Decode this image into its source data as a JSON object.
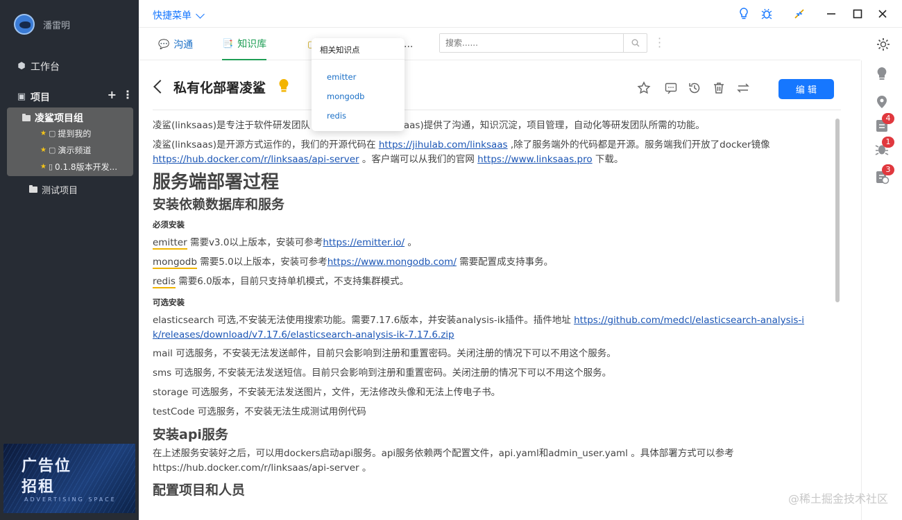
{
  "sidebar": {
    "username": "潘雷明",
    "workbench": "工作台",
    "projects": "项目",
    "group": {
      "title": "凌鲨项目组",
      "items": [
        {
          "label": "提到我的"
        },
        {
          "label": "演示频道"
        },
        {
          "label": "0.1.8版本开发..."
        }
      ]
    },
    "test_project": "测试项目",
    "ad": {
      "line1": "广告位",
      "line2": "招租",
      "line3": "ADVERTISING SPACE"
    }
  },
  "topbar": {
    "quick_menu": "快捷菜单"
  },
  "tabs": [
    {
      "label": "沟通"
    },
    {
      "label": "知识库"
    },
    {
      "label": "..."
    }
  ],
  "search": {
    "placeholder": "搜索......"
  },
  "rail_badges": {
    "b1": "4",
    "b2": "1",
    "b3": "3"
  },
  "doc": {
    "title": "私有化部署凌鲨",
    "edit_label": "编 辑",
    "p1a": "凌鲨(linksaas)是专注于软件研发团队",
    "p1b": "ksaas)提供了沟通，知识沉淀，项目管理，自动化等研发团队所需的功能。",
    "p2a": "凌鲨(linksaas)是开源方式运作的，我们的开源代码在 ",
    "p2_link1": "https://jihulab.com/linksaas",
    "p2b": " ,除了服务端外的代码都是开源。服务端我们开放了docker镜像",
    "p2_link2": "https://hub.docker.com/r/linksaas/api-server",
    "p2c": " 。客户端可以从我们的官网 ",
    "p2_link3": "https://www.linksaas.pro",
    "p2d": " 下载。",
    "h1": "服务端部署过程",
    "h2a": "安装依赖数据库和服务",
    "req_label": "必须安装",
    "emitter": "emitter",
    "emitter_text": " 需要v3.0以上版本，安装可参考",
    "emitter_link": "https://emitter.io/",
    "emitter_end": " 。",
    "mongodb": "mongodb",
    "mongodb_text": " 需要5.0以上版本，安装可参考",
    "mongodb_link": "https://www.mongodb.com/",
    "mongodb_end": " 需要配置成支持事务。",
    "redis": "redis",
    "redis_text": " 需要6.0版本，目前只支持单机模式，不支持集群模式。",
    "opt_label": "可选安装",
    "es_text": "elasticsearch 可选,不安装无法使用搜索功能。需要7.17.6版本，并安装analysis-ik插件。插件地址 ",
    "es_link": "https://github.com/medcl/elasticsearch-analysis-ik/releases/download/v7.17.6/elasticsearch-analysis-ik-7.17.6.zip",
    "mail": "mail 可选服务，不安装无法发送邮件，目前只会影响到注册和重置密码。关闭注册的情况下可以不用这个服务。",
    "sms": "sms 可选服务, 不安装无法发送短信。目前只会影响到注册和重置密码。关闭注册的情况下可以不用这个服务。",
    "storage": "storage 可选服务，不安装无法发送图片，文件，无法修改头像和无法上传电子书。",
    "testcode": "testCode 可选服务，不安装无法生成测试用例代码",
    "h2b": "安装api服务",
    "api_text": "在上述服务安装好之后，可以用dockers启动api服务。api服务依赖两个配置文件，api.yaml和admin_user.yaml 。具体部署方式可以参考",
    "api_link": "https://hub.docker.com/r/linksaas/api-server",
    "api_end": " 。",
    "h2c": "配置项目和人员"
  },
  "popover": {
    "title": "相关知识点",
    "items": [
      "emitter",
      "mongodb",
      "redis"
    ]
  },
  "watermark": "@稀土掘金技术社区"
}
